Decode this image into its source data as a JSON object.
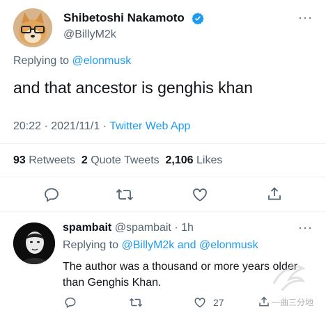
{
  "main_tweet": {
    "display_name": "Shibetoshi Nakamoto",
    "handle": "@BillyM2k",
    "replying_prefix": "Replying to",
    "replying_to": "@elonmusk",
    "text": "and that ancestor is genghis khan",
    "time": "20:22",
    "date": "2021/11/1",
    "client": "Twitter Web App",
    "retweets_count": "93",
    "retweets_label": "Retweets",
    "quotes_count": "2",
    "quotes_label": "Quote Tweets",
    "likes_count": "2,106",
    "likes_label": "Likes",
    "verified_icon": "verified-badge-icon"
  },
  "reply": {
    "display_name": "spambait",
    "handle": "@spambait",
    "age": "1h",
    "replying_prefix": "Replying to",
    "replying_to_1": "@BillyM2k",
    "and": "and",
    "replying_to_2": "@elonmusk",
    "text": "The author was a thousand or more years older than Genghis Khan.",
    "likes_count": "27"
  },
  "watermark": "一曲三分地",
  "colors": {
    "accent": "#1d9bf0",
    "secondary_text": "#536471",
    "divider": "#eff3f4"
  }
}
